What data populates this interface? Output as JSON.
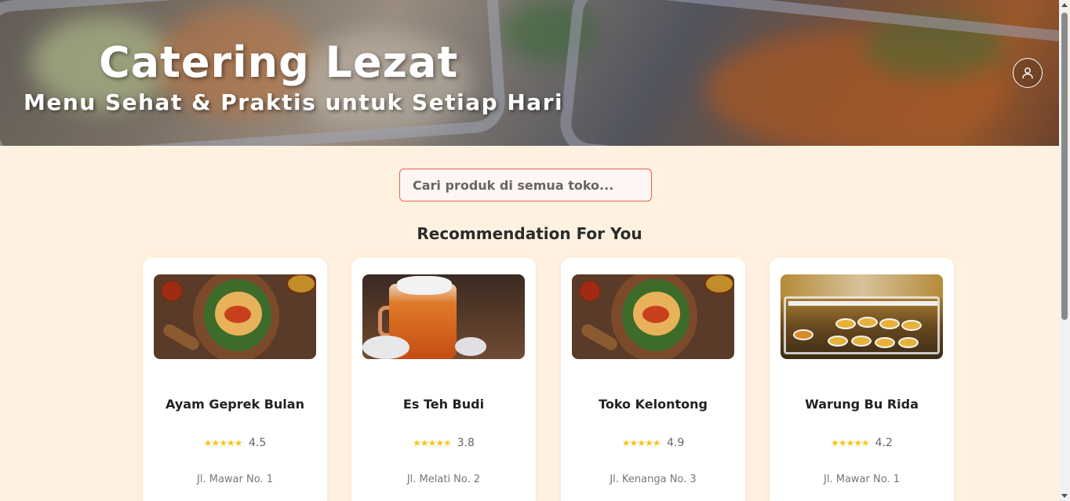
{
  "header": {
    "title": "Catering Lezat",
    "subtitle": "Menu Sehat & Praktis untuk Setiap Hari",
    "profile_icon": "user-icon"
  },
  "search": {
    "placeholder": "Cari produk di semua toko..."
  },
  "recommendations": {
    "title": "Recommendation For You",
    "items": [
      {
        "name": "Ayam Geprek Bulan",
        "stars": "★★★★★",
        "rating": "4.5",
        "address": "Jl. Mawar No. 1",
        "image": "ayam-geprek-plate"
      },
      {
        "name": "Es Teh Budi",
        "stars": "★★★★✬",
        "rating": "3.8",
        "address": "Jl. Melati No. 2",
        "image": "iced-tea-jar"
      },
      {
        "name": "Toko Kelontong",
        "stars": "★★★★★",
        "rating": "4.9",
        "address": "Jl. Kenanga No. 3",
        "image": "ayam-geprek-plate"
      },
      {
        "name": "Warung Bu Rida",
        "stars": "★★★★✬",
        "rating": "4.2",
        "address": "Jl. Mawar No. 1",
        "image": "food-display-case"
      }
    ]
  },
  "colors": {
    "page_bg": "#fef1df",
    "star": "#f5c518",
    "search_border": "#e0664f"
  }
}
